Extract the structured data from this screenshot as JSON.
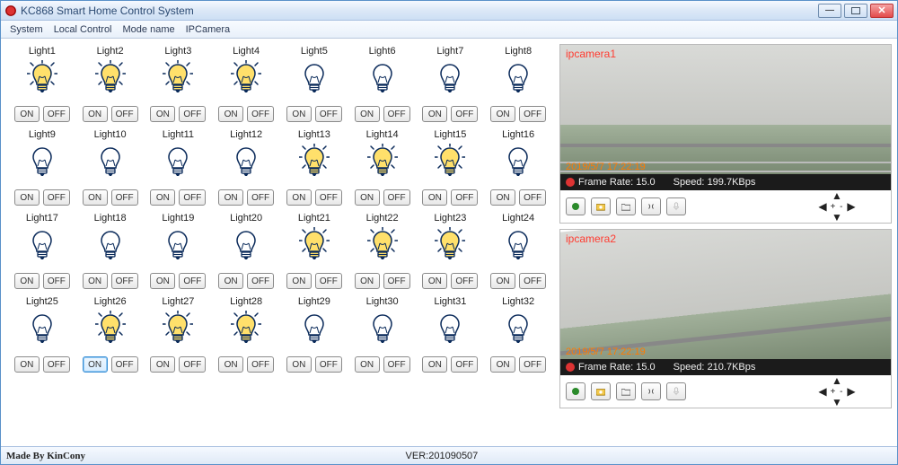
{
  "title": "KC868 Smart Home Control System",
  "menu": [
    "System",
    "Local Control",
    "Mode name",
    "IPCamera"
  ],
  "buttons": {
    "on": "ON",
    "off": "OFF"
  },
  "lights": [
    {
      "label": "Light1",
      "on": true
    },
    {
      "label": "Light2",
      "on": true
    },
    {
      "label": "Light3",
      "on": true
    },
    {
      "label": "Light4",
      "on": true
    },
    {
      "label": "Light5",
      "on": false
    },
    {
      "label": "Light6",
      "on": false
    },
    {
      "label": "Light7",
      "on": false
    },
    {
      "label": "Light8",
      "on": false
    },
    {
      "label": "Light9",
      "on": false
    },
    {
      "label": "Light10",
      "on": false
    },
    {
      "label": "Light11",
      "on": false
    },
    {
      "label": "Light12",
      "on": false
    },
    {
      "label": "Light13",
      "on": true
    },
    {
      "label": "Light14",
      "on": true
    },
    {
      "label": "Light15",
      "on": true
    },
    {
      "label": "Light16",
      "on": false
    },
    {
      "label": "Light17",
      "on": false
    },
    {
      "label": "Light18",
      "on": false
    },
    {
      "label": "Light19",
      "on": false
    },
    {
      "label": "Light20",
      "on": false
    },
    {
      "label": "Light21",
      "on": true
    },
    {
      "label": "Light22",
      "on": true
    },
    {
      "label": "Light23",
      "on": true
    },
    {
      "label": "Light24",
      "on": false
    },
    {
      "label": "Light25",
      "on": false
    },
    {
      "label": "Light26",
      "on": true,
      "active_on": true
    },
    {
      "label": "Light27",
      "on": true
    },
    {
      "label": "Light28",
      "on": true
    },
    {
      "label": "Light29",
      "on": false
    },
    {
      "label": "Light30",
      "on": false
    },
    {
      "label": "Light31",
      "on": false
    },
    {
      "label": "Light32",
      "on": false
    }
  ],
  "cameras": [
    {
      "name": "ipcamera1",
      "timestamp": "2019/5/7 17:22:19",
      "frame_label": "Frame Rate:",
      "frame_value": "15.0",
      "speed_label": "Speed:",
      "speed_value": "199.7KBps"
    },
    {
      "name": "ipcamera2",
      "timestamp": "2019/5/7 17:22:19",
      "frame_label": "Frame Rate:",
      "frame_value": "15.0",
      "speed_label": "Speed:",
      "speed_value": "210.7KBps"
    }
  ],
  "status": {
    "made": "Made By KinCony",
    "ver": "VER:201090507"
  },
  "colors": {
    "bulb_on_fill": "#ffe06b",
    "bulb_off_fill": "#ffffff",
    "bulb_stroke": "#0a2a5a",
    "ray": "#0a2a5a"
  }
}
